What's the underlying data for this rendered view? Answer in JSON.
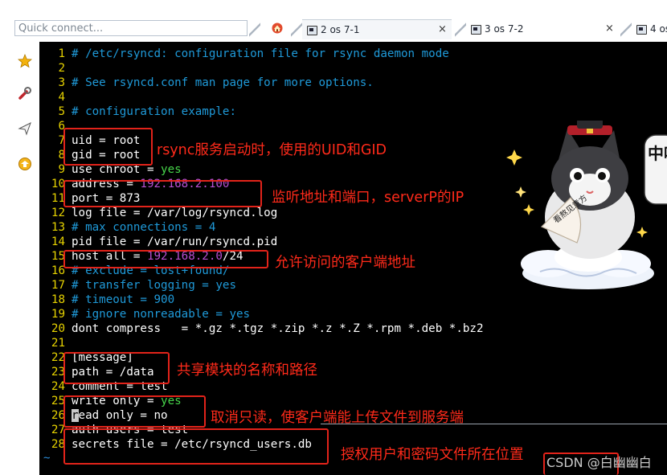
{
  "toolbar": {
    "quick_connect_placeholder": "Quick connect..."
  },
  "tabs": [
    {
      "label": "2  os 7-1",
      "active": true
    },
    {
      "label": "3  os 7-2",
      "active": false
    },
    {
      "label": "4  os",
      "active": false
    }
  ],
  "tab_close": "×",
  "lines": [
    {
      "n": "1",
      "segs": [
        {
          "t": "# /etc/rsyncd: configuration file for rsync daemon mode",
          "c": "cm"
        }
      ]
    },
    {
      "n": "2",
      "segs": []
    },
    {
      "n": "3",
      "segs": [
        {
          "t": "# See rsyncd.conf man page for more options.",
          "c": "cm"
        }
      ]
    },
    {
      "n": "4",
      "segs": []
    },
    {
      "n": "5",
      "segs": [
        {
          "t": "# configuration example:",
          "c": "cm"
        }
      ]
    },
    {
      "n": "6",
      "segs": []
    },
    {
      "n": "7",
      "segs": [
        {
          "t": "uid = root",
          "c": "w"
        }
      ]
    },
    {
      "n": "8",
      "segs": [
        {
          "t": "gid = root",
          "c": "w"
        }
      ]
    },
    {
      "n": "9",
      "segs": [
        {
          "t": "use chroot = ",
          "c": "w"
        },
        {
          "t": "yes",
          "c": "kw"
        }
      ]
    },
    {
      "n": "10",
      "segs": [
        {
          "t": "address = ",
          "c": "w"
        },
        {
          "t": "192.168.2.100",
          "c": "vl"
        }
      ]
    },
    {
      "n": "11",
      "segs": [
        {
          "t": "port = 873",
          "c": "w"
        }
      ]
    },
    {
      "n": "12",
      "segs": [
        {
          "t": "log file = /var/log/rsyncd.log",
          "c": "w"
        }
      ]
    },
    {
      "n": "13",
      "segs": [
        {
          "t": "# max connections = 4",
          "c": "cm"
        }
      ]
    },
    {
      "n": "14",
      "segs": [
        {
          "t": "pid file = /var/run/rsyncd.pid",
          "c": "w"
        }
      ]
    },
    {
      "n": "15",
      "segs": [
        {
          "t": "host all = ",
          "c": "w"
        },
        {
          "t": "192.168.2.0",
          "c": "vl"
        },
        {
          "t": "/24",
          "c": "w"
        }
      ]
    },
    {
      "n": "16",
      "segs": [
        {
          "t": "# exclude = lost+found/",
          "c": "cm"
        }
      ]
    },
    {
      "n": "17",
      "segs": [
        {
          "t": "# transfer logging = yes",
          "c": "cm"
        }
      ]
    },
    {
      "n": "18",
      "segs": [
        {
          "t": "# timeout = 900",
          "c": "cm"
        }
      ]
    },
    {
      "n": "19",
      "segs": [
        {
          "t": "# ignore nonreadable = yes",
          "c": "cm"
        }
      ]
    },
    {
      "n": "20",
      "segs": [
        {
          "t": "dont compress   = *.gz *.tgz *.zip *.z *.Z *.rpm *.deb *.bz2",
          "c": "w"
        }
      ]
    },
    {
      "n": "21",
      "segs": []
    },
    {
      "n": "22",
      "segs": [
        {
          "t": "[message]",
          "c": "w"
        }
      ]
    },
    {
      "n": "23",
      "segs": [
        {
          "t": "path = /data",
          "c": "w"
        }
      ]
    },
    {
      "n": "24",
      "segs": [
        {
          "t": "comment = test",
          "c": "w"
        }
      ]
    },
    {
      "n": "25",
      "segs": [
        {
          "t": "write only = ",
          "c": "w"
        },
        {
          "t": "yes",
          "c": "kw"
        }
      ]
    },
    {
      "n": "26",
      "segs": [
        {
          "t": "r",
          "c": "cursor"
        },
        {
          "t": "ead only = no",
          "c": "w"
        }
      ]
    },
    {
      "n": "27",
      "segs": [
        {
          "t": "auth users = test",
          "c": "w"
        }
      ]
    },
    {
      "n": "28",
      "segs": [
        {
          "t": "secrets file = /etc/rsyncd_users.db",
          "c": "w"
        }
      ]
    }
  ],
  "tilde": "~",
  "annotations": {
    "uid_gid": "rsync服务启动时，使用的UID和GID",
    "address_port": "监听地址和端口，serverP的IP",
    "host_all": "允许访问的客户端地址",
    "module": "共享模块的名称和路径",
    "readonly": "取消只读，使客户端能上传文件到服务端",
    "auth": "授权用户和密码文件所在位置"
  },
  "mascot_fan_text": "看熬见意方",
  "mascot_side_text": "中吗",
  "watermark": "CSDN @白幽幽白",
  "colors": {
    "terminal_bg": "#000000",
    "line_number": "#e6d200",
    "comment": "#1f9ad9",
    "ip_value": "#b94fd1",
    "keyword_yes": "#47d64a",
    "annotation_red": "#ff2a1a"
  }
}
